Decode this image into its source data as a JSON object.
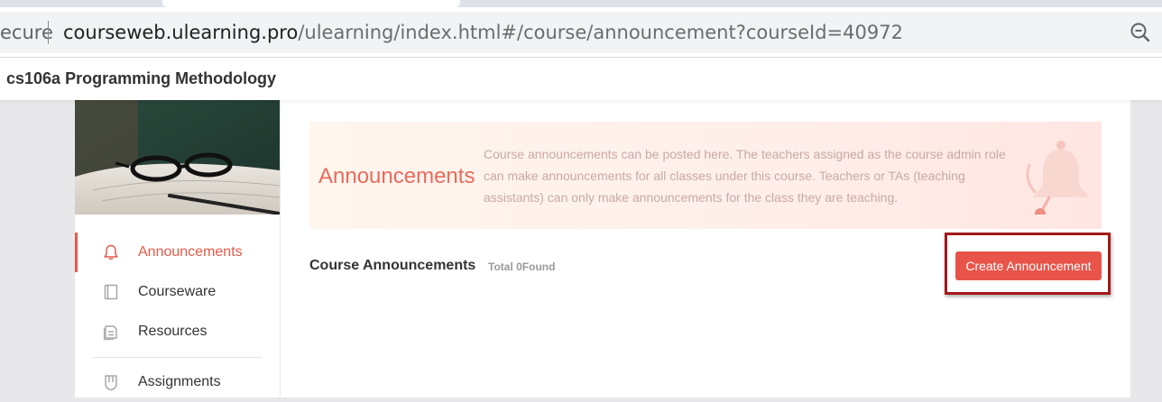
{
  "browser": {
    "security_text": "ecure",
    "url_host": "courseweb.ulearning.pro",
    "url_path": "/ulearning/index.html#/course/announcement?courseId=40972",
    "zoom_icon": "zoom-out-icon"
  },
  "header": {
    "course_title": "cs106a Programming Methodology"
  },
  "sidebar": {
    "items": [
      {
        "label": "Announcements",
        "icon": "bell-icon",
        "active": true
      },
      {
        "label": "Courseware",
        "icon": "book-icon",
        "active": false
      },
      {
        "label": "Resources",
        "icon": "resources-icon",
        "active": false
      },
      {
        "label": "Assignments",
        "icon": "assignment-icon",
        "active": false
      }
    ]
  },
  "banner": {
    "title": "Announcements",
    "description": "Course announcements can be posted here. The teachers assigned as the course admin role can make announcements for all classes under this course. Teachers or TAs (teaching assistants) can only make announcements for the class they are teaching."
  },
  "announcements": {
    "section_title": "Course Announcements",
    "count_text": "Total 0Found",
    "create_label": "Create Announcement"
  },
  "colors": {
    "accent": "#e8544a",
    "highlight_border": "#a31a1a"
  }
}
